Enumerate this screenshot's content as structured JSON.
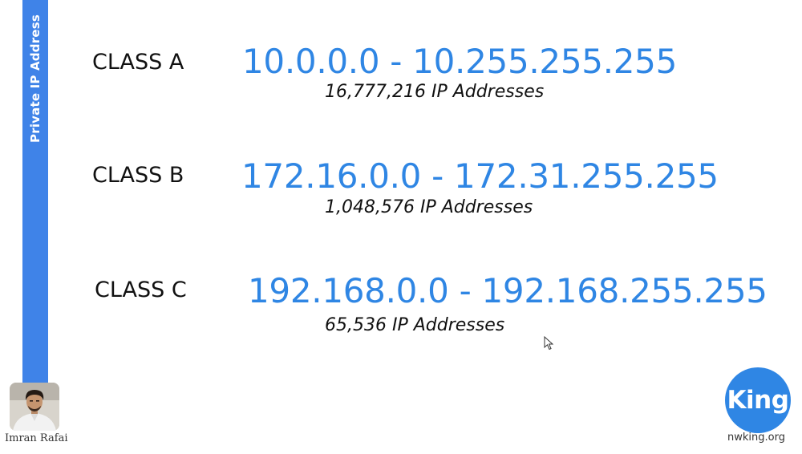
{
  "sidebar": {
    "title": "Private IP Address",
    "color": "#3f83e8"
  },
  "rows": [
    {
      "class_label": "CLASS A",
      "range": "10.0.0.0 - 10.255.255.255",
      "count": "16,777,216 IP Addresses"
    },
    {
      "class_label": "CLASS B",
      "range": "172.16.0.0 - 172.31.255.255",
      "count": "1,048,576 IP Addresses"
    },
    {
      "class_label": "CLASS C",
      "range": "192.168.0.0 - 192.168.255.255",
      "count": "65,536 IP Addresses"
    }
  ],
  "presenter": {
    "name": "Imran Rafai"
  },
  "logo": {
    "text": "King",
    "url": "nwking.org",
    "color": "#2f86e4"
  },
  "colors": {
    "range_text": "#2f86e4",
    "body_text": "#111111",
    "background": "#ffffff"
  },
  "icons": {
    "cursor": "mouse-pointer-icon"
  }
}
